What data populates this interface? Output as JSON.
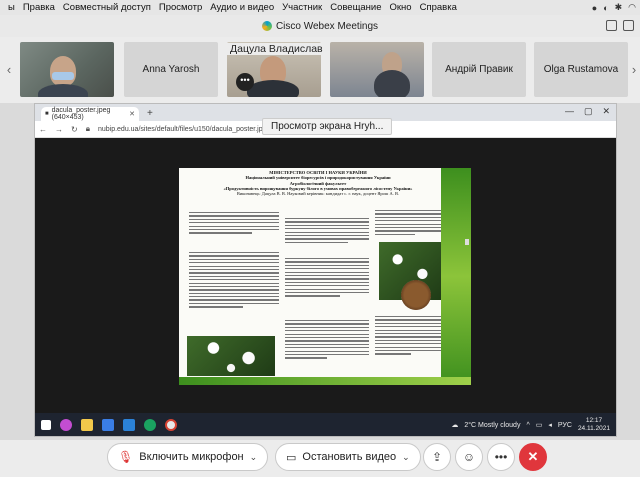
{
  "menubar": {
    "items": [
      "ы",
      "Правка",
      "Совместный доступ",
      "Просмотр",
      "Аудио и видео",
      "Участник",
      "Совещание",
      "Окно",
      "Справка"
    ]
  },
  "window": {
    "title": "Cisco Webex Meetings"
  },
  "participants": {
    "presenter_name": "Дацула Владислав",
    "tiles": [
      "Anna Yarosh",
      "Андрій Правик",
      "Olga Rustamova"
    ],
    "more_label": "•••"
  },
  "share": {
    "label": "Просмотр экрана Hryh...",
    "browser": {
      "tab_title": "dacula_poster.jpeg (640×453)",
      "url": "nubip.edu.ua/sites/default/files/u150/dacula_poster.jpeg"
    },
    "poster": {
      "heading_1": "МІНІСТЕРСТВО ОСВІТИ І НАУКИ УКРАЇНИ",
      "heading_2": "Національний університет біоресурсів і природокористування України",
      "heading_3": "Агробіологічний факультет",
      "heading_4": "«Продуктивність вирощування буркуну білого в умовах правобережного лісостепу України»",
      "authors": "Виконавець: Дацула В. В.   Науковий керівник: кандидат с. г. наук, доцент Ярош А. В."
    },
    "taskbar": {
      "weather": "2°C  Mostly cloudy",
      "lang": "РУС",
      "time": "12:17",
      "date": "24.11.2021"
    }
  },
  "controls": {
    "mic_label": "Включить микрофон",
    "video_label": "Остановить видео"
  },
  "colors": {
    "end_call": "#e0363c",
    "poster_green": "#3d8f1e"
  }
}
